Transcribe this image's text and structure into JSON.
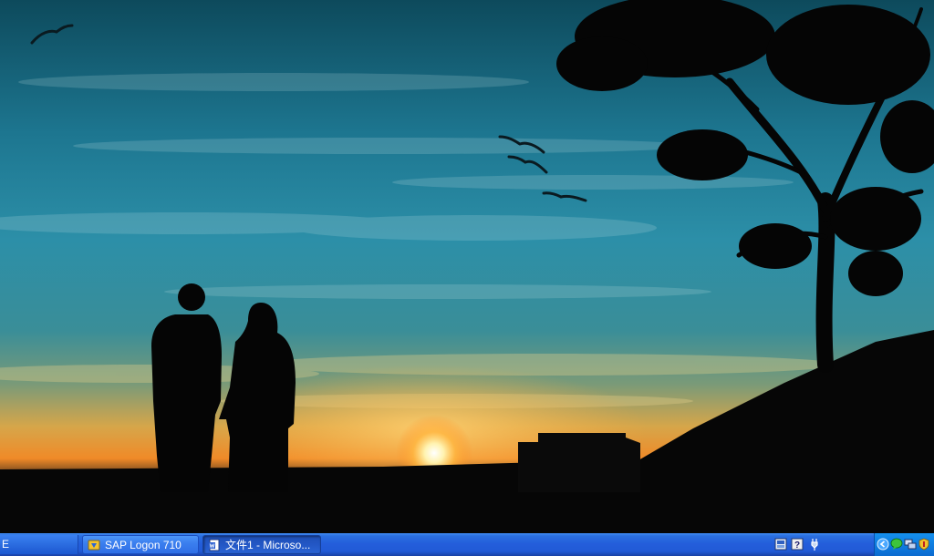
{
  "taskbar": {
    "start_label": "E",
    "buttons": [
      {
        "label": "SAP Logon 710",
        "icon": "sap-logon-icon",
        "active": false
      },
      {
        "label": "文件1 - Microso...",
        "icon": "word-document-icon",
        "active": true
      }
    ],
    "quicklaunch_icons": [
      "app-tray-icon",
      "help-icon",
      "network-plug-icon"
    ],
    "notification_icons": [
      "chevron-left-icon",
      "messenger-icon",
      "network-icon",
      "security-shield-icon"
    ]
  },
  "colors": {
    "taskbar_blue": "#245edb",
    "active_button": "#1e4fb6",
    "tray_blue": "#0f7de0"
  }
}
